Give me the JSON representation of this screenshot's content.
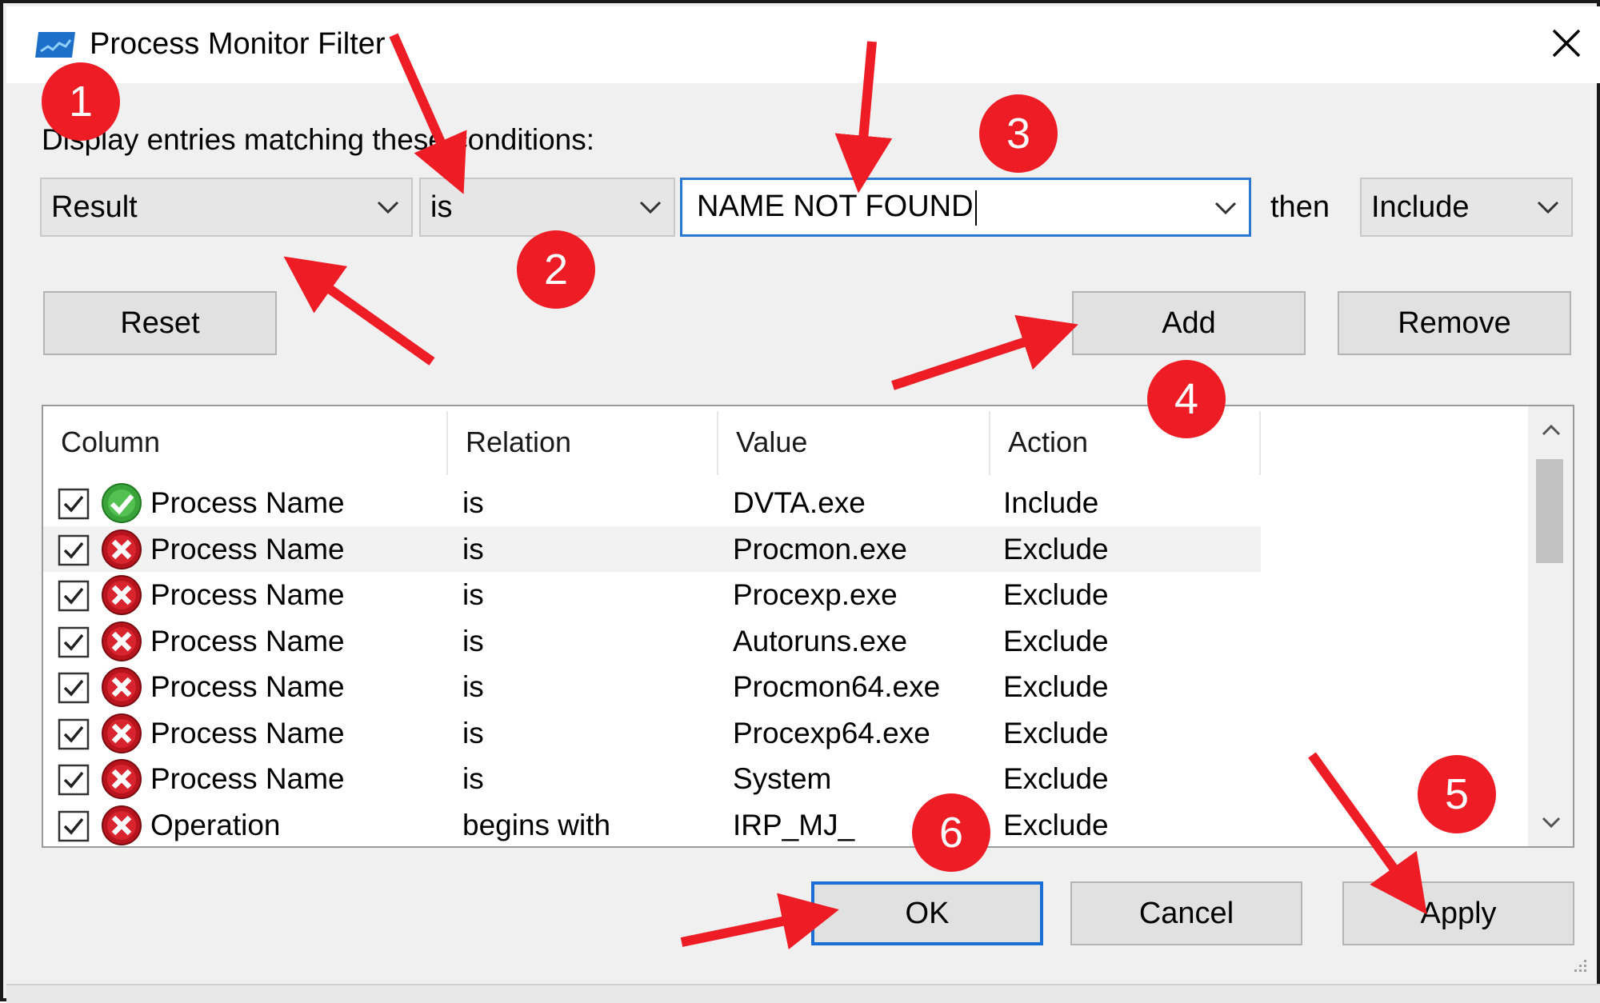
{
  "window": {
    "title": "Process Monitor Filter",
    "close_label": "×"
  },
  "filter_builder": {
    "label": "Display entries matching these conditions:",
    "column_value": "Result",
    "relation_value": "is",
    "value_text": "NAME NOT FOUND",
    "then_label": "then",
    "action_value": "Include"
  },
  "buttons": {
    "reset": "Reset",
    "add": "Add",
    "remove": "Remove",
    "ok": "OK",
    "cancel": "Cancel",
    "apply": "Apply"
  },
  "table": {
    "columns": [
      "Column",
      "Relation",
      "Value",
      "Action"
    ],
    "rows": [
      {
        "checked": true,
        "icon": "include-check-icon",
        "column": "Process Name",
        "relation": "is",
        "value": "DVTA.exe",
        "action": "Include"
      },
      {
        "checked": true,
        "icon": "exclude-x-icon",
        "column": "Process Name",
        "relation": "is",
        "value": "Procmon.exe",
        "action": "Exclude",
        "selected": true
      },
      {
        "checked": true,
        "icon": "exclude-x-icon",
        "column": "Process Name",
        "relation": "is",
        "value": "Procexp.exe",
        "action": "Exclude"
      },
      {
        "checked": true,
        "icon": "exclude-x-icon",
        "column": "Process Name",
        "relation": "is",
        "value": "Autoruns.exe",
        "action": "Exclude"
      },
      {
        "checked": true,
        "icon": "exclude-x-icon",
        "column": "Process Name",
        "relation": "is",
        "value": "Procmon64.exe",
        "action": "Exclude"
      },
      {
        "checked": true,
        "icon": "exclude-x-icon",
        "column": "Process Name",
        "relation": "is",
        "value": "Procexp64.exe",
        "action": "Exclude"
      },
      {
        "checked": true,
        "icon": "exclude-x-icon",
        "column": "Process Name",
        "relation": "is",
        "value": "System",
        "action": "Exclude"
      },
      {
        "checked": true,
        "icon": "exclude-x-icon",
        "column": "Operation",
        "relation": "begins with",
        "value": "IRP_MJ_",
        "action": "Exclude"
      }
    ]
  },
  "annotations": {
    "badges": [
      "1",
      "2",
      "3",
      "4",
      "5",
      "6"
    ],
    "color": "#ee1c24"
  },
  "colors": {
    "focus_border": "#2a78d0",
    "default_button_border": "#1a6fd4",
    "include_icon": "#3aa43a",
    "exclude_icon": "#d0202a"
  }
}
